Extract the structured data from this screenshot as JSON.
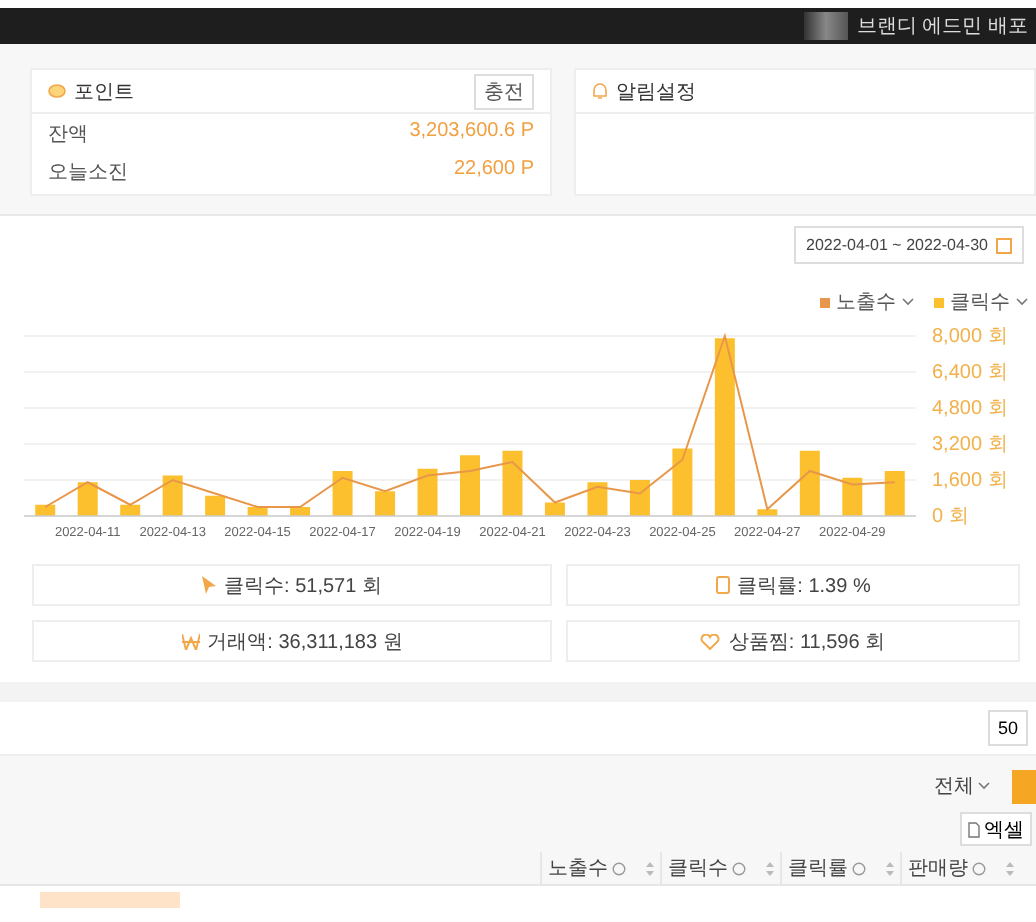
{
  "top_bar": {
    "user_text": "브랜디 에드민 배포"
  },
  "point_card": {
    "title": "포인트",
    "charge_button": "충전",
    "rows": [
      {
        "label": "잔액",
        "value": "3,203,600.6 P"
      },
      {
        "label": "오늘소진",
        "value": "22,600 P"
      }
    ]
  },
  "alert_card": {
    "title": "알림설정"
  },
  "date_range": "2022-04-01 ~ 2022-04-30",
  "chart_data": {
    "type": "bar",
    "stacked": false,
    "grid": true,
    "categories": [
      null,
      "2022-04-11",
      null,
      "2022-04-13",
      null,
      "2022-04-15",
      null,
      "2022-04-17",
      null,
      "2022-04-19",
      null,
      "2022-04-21",
      null,
      "2022-04-23",
      null,
      "2022-04-25",
      null,
      "2022-04-27",
      null,
      "2022-04-29",
      null
    ],
    "ylim": [
      0,
      8000
    ],
    "yticks": [
      {
        "value": 0,
        "label": "0 회"
      },
      {
        "value": 1600,
        "label": "1,600 회"
      },
      {
        "value": 3200,
        "label": "3,200 회"
      },
      {
        "value": 4800,
        "label": "4,800 회"
      },
      {
        "value": 6400,
        "label": "6,400 회"
      },
      {
        "value": 8000,
        "label": "8,000 회"
      }
    ],
    "series": [
      {
        "name": "노출수",
        "type": "line",
        "color": "#e8964a",
        "values": [
          400,
          1500,
          500,
          1600,
          1000,
          400,
          400,
          1700,
          1100,
          1800,
          2000,
          2400,
          600,
          1300,
          1000,
          2500,
          8000,
          300,
          2000,
          1400,
          1500
        ]
      },
      {
        "name": "클릭수",
        "type": "bar",
        "color": "#fcc02e",
        "values": [
          500,
          1500,
          500,
          1800,
          900,
          400,
          400,
          2000,
          1100,
          2100,
          2700,
          2900,
          600,
          1500,
          1600,
          3000,
          7900,
          300,
          2900,
          1700,
          2000
        ]
      }
    ]
  },
  "stats": [
    {
      "kind": "cursor",
      "text": "클릭수: 51,571 회"
    },
    {
      "kind": "doc",
      "text": "클릭률: 1.39 %"
    },
    {
      "kind": "won",
      "text": "거래액: 36,311,183 원"
    },
    {
      "kind": "heart",
      "text": "상품찜: 11,596 회"
    }
  ],
  "page_size": "50",
  "filter": "전체",
  "excel_button": "엑셀",
  "table": {
    "columns": [
      "노출수",
      "클릭수",
      "클릭률",
      "판매량"
    ]
  }
}
